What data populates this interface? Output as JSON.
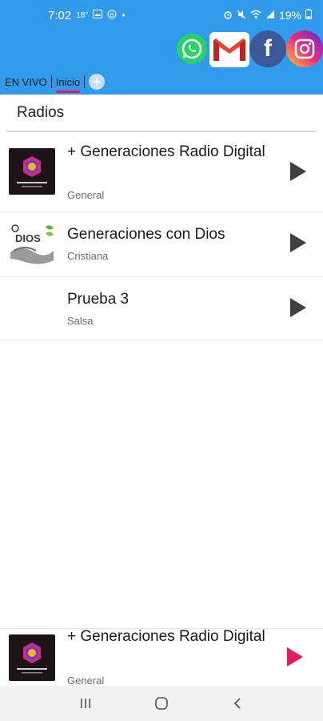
{
  "status_bar": {
    "time": "7:02",
    "temperature": "18°",
    "battery": "19%",
    "icons": [
      "weather-icon",
      "gallery-icon",
      "app-icon",
      "dot-icon",
      "alarm-icon",
      "mute-icon",
      "wifi-icon",
      "signal-icon",
      "battery-icon"
    ]
  },
  "social": [
    "whatsapp-icon",
    "gmail-icon",
    "facebook-icon",
    "instagram-icon"
  ],
  "tabs": [
    {
      "label": "EN VIVO"
    },
    {
      "label": "Inicio",
      "active": true
    }
  ],
  "add_tab": "+",
  "section": {
    "title": "Radios"
  },
  "radios": [
    {
      "title": "+ Generaciones Radio Digital",
      "genre": "General"
    },
    {
      "title": "Generaciones con Dios",
      "genre": "Cristiana"
    },
    {
      "title": "Prueba 3",
      "genre": "Salsa"
    }
  ],
  "player": {
    "title": "+ Generaciones Radio Digital",
    "genre": "General"
  },
  "colors": {
    "primary": "#2f9bea",
    "accent": "#e8195a",
    "play": "#404040"
  }
}
